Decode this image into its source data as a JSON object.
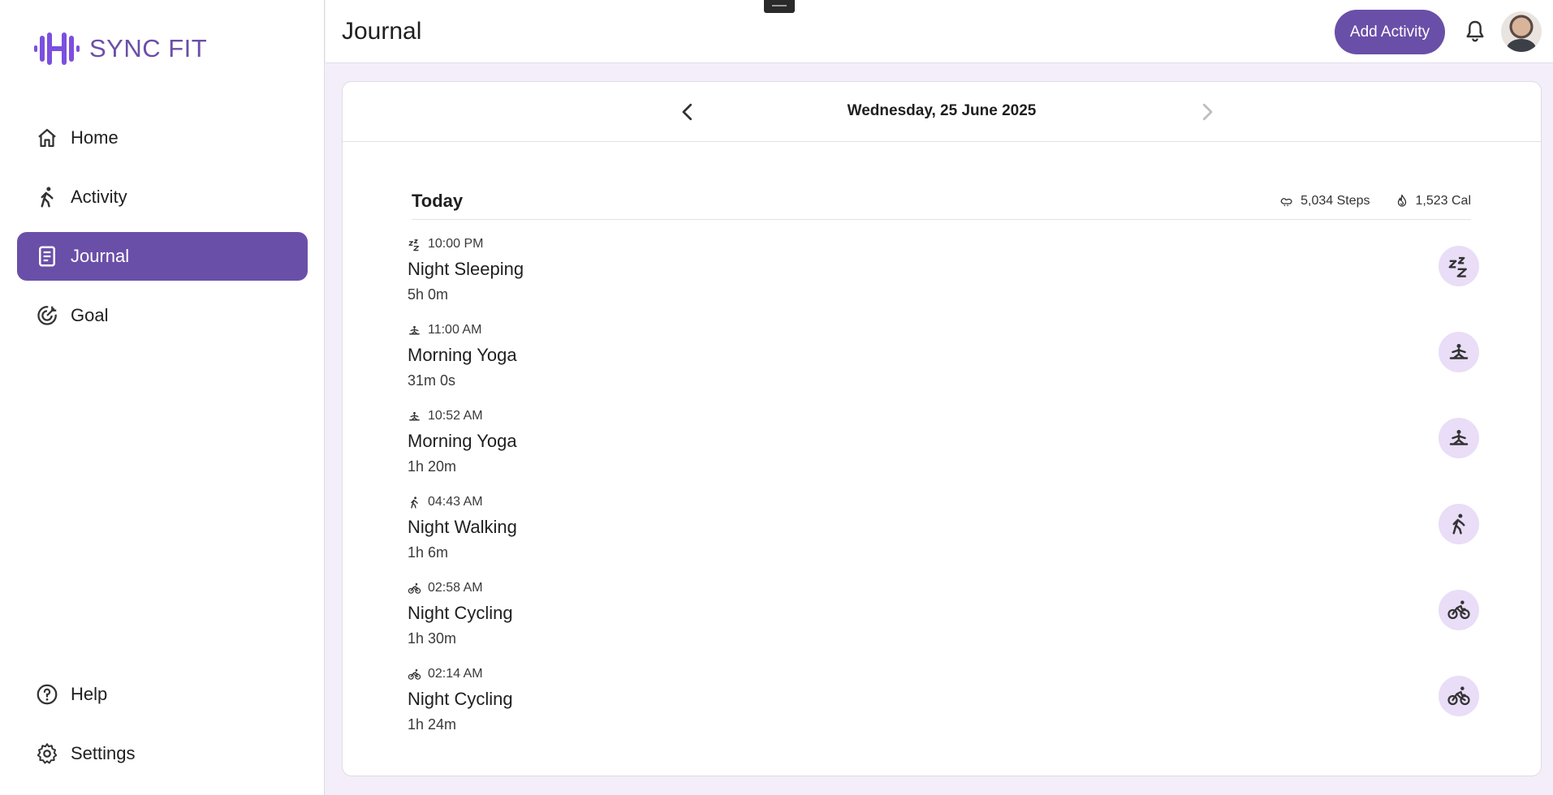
{
  "app": {
    "brand_name": "SYNC FIT",
    "brand_color": "#6b4fa8",
    "accent_color": "#6a4fa8",
    "chip_color": "#e9ddf7"
  },
  "sidebar": {
    "items": [
      {
        "label": "Home",
        "icon": "home-icon"
      },
      {
        "label": "Activity",
        "icon": "walk-icon"
      },
      {
        "label": "Journal",
        "icon": "journal-icon",
        "active": true
      },
      {
        "label": "Goal",
        "icon": "target-icon"
      }
    ],
    "bottom_items": [
      {
        "label": "Help",
        "icon": "help-icon"
      },
      {
        "label": "Settings",
        "icon": "gear-icon"
      }
    ]
  },
  "header": {
    "title": "Journal",
    "add_button_label": "Add Activity"
  },
  "journal": {
    "date_label": "Wednesday, 25 June 2025",
    "day_title": "Today",
    "steps_label": "5,034 Steps",
    "calories_label": "1,523 Cal",
    "entries": [
      {
        "time": "10:00 PM",
        "title": "Night Sleeping",
        "duration": "5h 0m",
        "icon": "sleep-icon"
      },
      {
        "time": "11:00 AM",
        "title": "Morning Yoga",
        "duration": "31m 0s",
        "icon": "yoga-icon"
      },
      {
        "time": "10:52 AM",
        "title": "Morning Yoga",
        "duration": "1h 20m",
        "icon": "yoga-icon"
      },
      {
        "time": "04:43 AM",
        "title": "Night Walking",
        "duration": "1h 6m",
        "icon": "walk-icon"
      },
      {
        "time": "02:58 AM",
        "title": "Night Cycling",
        "duration": "1h 30m",
        "icon": "bike-icon"
      },
      {
        "time": "02:14 AM",
        "title": "Night Cycling",
        "duration": "1h 24m",
        "icon": "bike-icon"
      }
    ]
  }
}
